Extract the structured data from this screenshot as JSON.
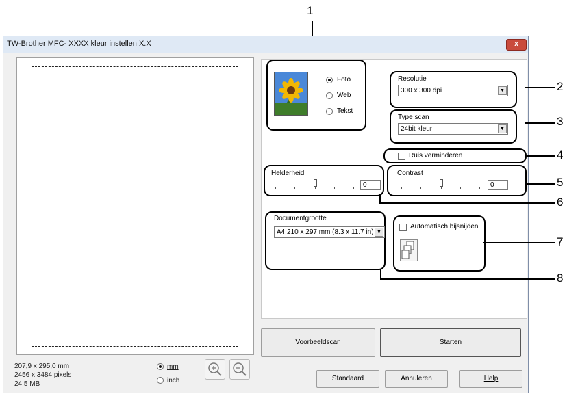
{
  "window": {
    "title": "TW-Brother MFC- XXXX    kleur instellen X.X",
    "close_glyph": "x"
  },
  "preview_info": {
    "size_mm": "207,9 x 295,0 mm",
    "size_px": "2456 x 3484 pixels",
    "file_size": "24,5 MB"
  },
  "units": {
    "mm": "mm",
    "inch": "inch",
    "selected": "mm"
  },
  "zoom": {
    "in_icon": "zoom-in-icon",
    "out_icon": "zoom-out-icon"
  },
  "image_type": {
    "options": [
      "Foto",
      "Web",
      "Tekst"
    ],
    "selected": "Foto",
    "icon": "sunflower-photo-icon"
  },
  "resolution": {
    "label": "Resolutie",
    "value": "300 x 300 dpi"
  },
  "scan_type": {
    "label": "Type scan",
    "value": "24bit kleur"
  },
  "noise": {
    "label": "Ruis verminderen",
    "checked": false
  },
  "brightness": {
    "label": "Helderheid",
    "value": "0"
  },
  "contrast": {
    "label": "Contrast",
    "value": "0"
  },
  "document_size": {
    "label": "Documentgrootte",
    "value": "A4 210 x 297 mm (8.3 x 11.7 in)"
  },
  "auto_crop": {
    "label": "Automatisch bijsnijden",
    "checked": false,
    "icon": "multi-page-icon"
  },
  "buttons": {
    "preview_scan": "Voorbeeldscan",
    "start": "Starten",
    "default": "Standaard",
    "cancel": "Annuleren",
    "help": "Help"
  },
  "callouts": [
    "1",
    "2",
    "3",
    "4",
    "5",
    "6",
    "7",
    "8"
  ],
  "colors": {
    "titlebar": "#dfe9f5",
    "close": "#c94b3d",
    "panel": "#f0f0f0"
  }
}
